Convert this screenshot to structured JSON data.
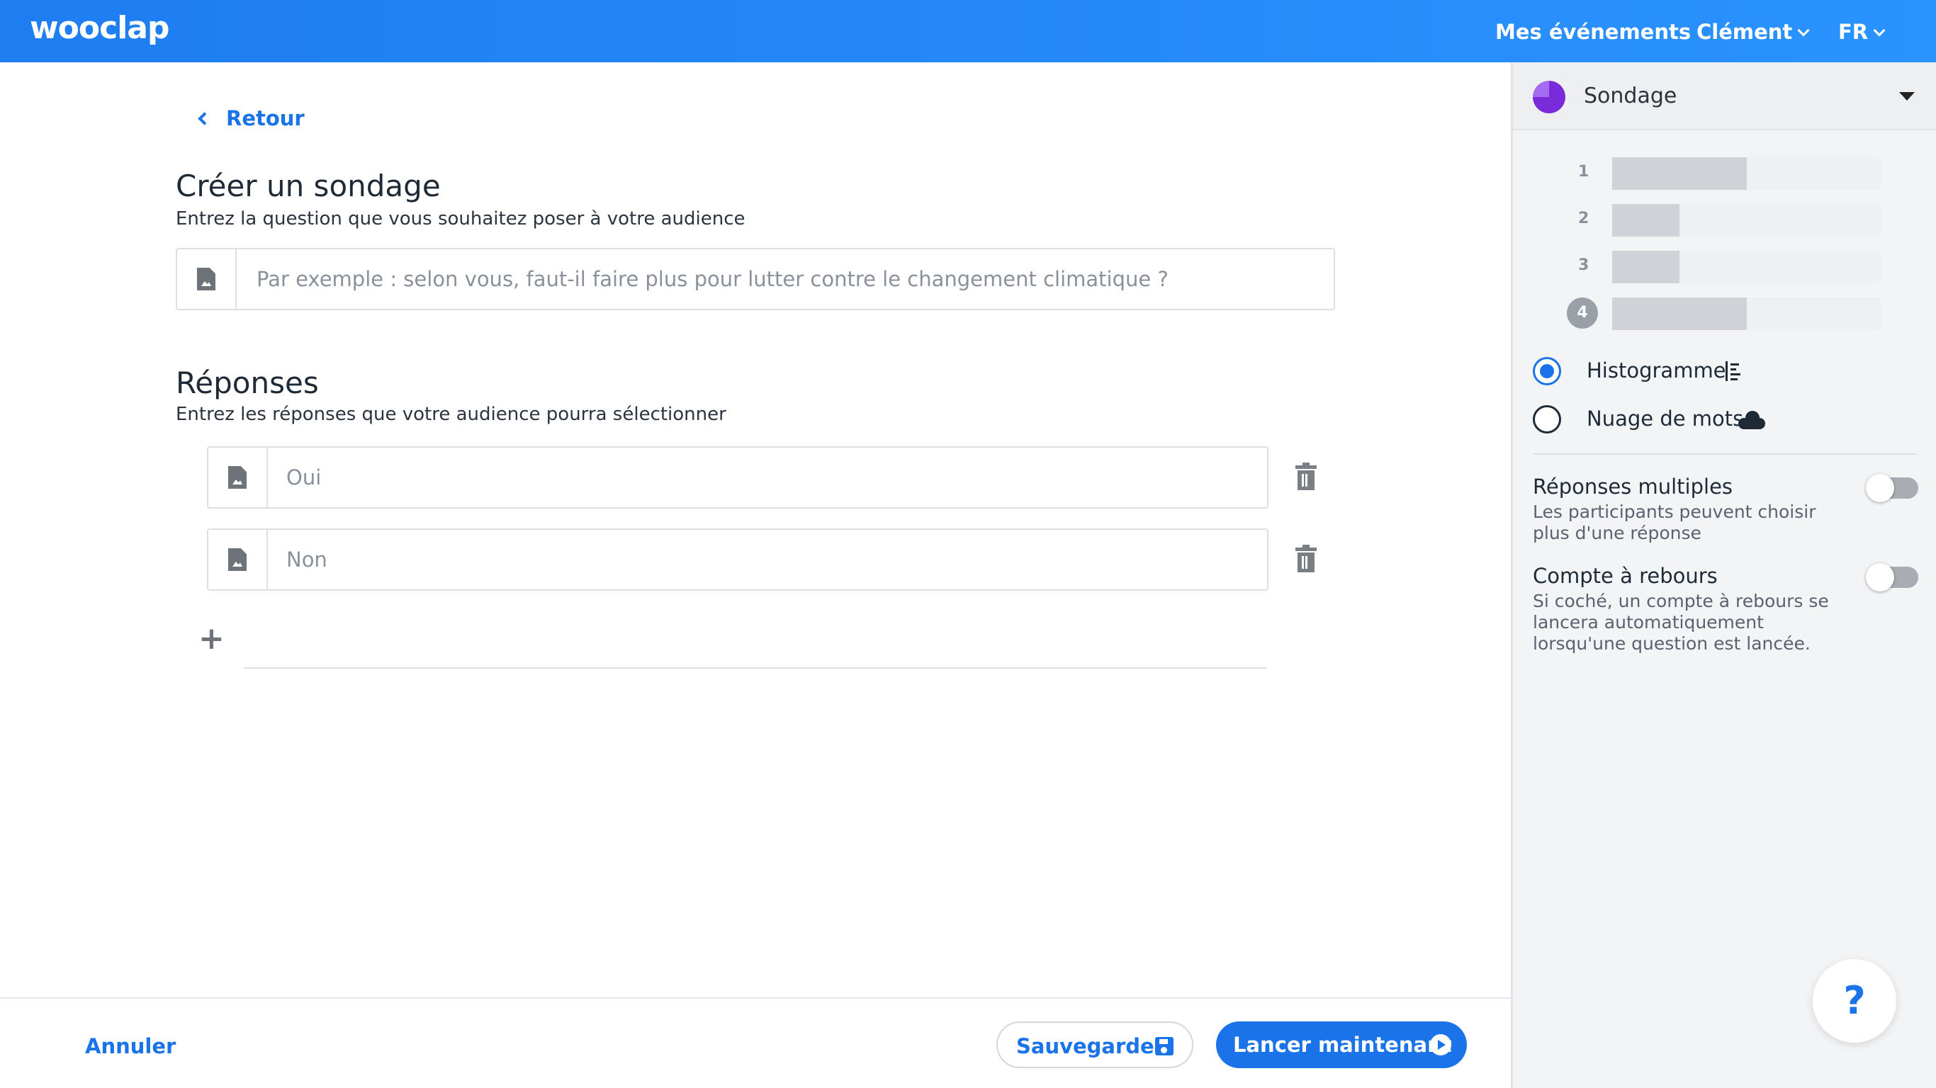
{
  "header": {
    "logo": "wooclap",
    "events_label": "Mes événements",
    "user_label": "Clément",
    "lang_label": "FR"
  },
  "main": {
    "back_label": "Retour",
    "title": "Créer un sondage",
    "subtitle": "Entrez la question que vous souhaitez poser à votre audience",
    "question_placeholder": "Par exemple : selon vous, faut-il faire plus pour lutter contre le changement climatique ?",
    "answers_title": "Réponses",
    "answers_subtitle": "Entrez les réponses que votre audience pourra sélectionner",
    "answers": [
      {
        "placeholder": "Oui"
      },
      {
        "placeholder": "Non"
      }
    ],
    "add_label": "+"
  },
  "footer": {
    "cancel_label": "Annuler",
    "save_label": "Sauvegarder",
    "launch_label": "Lancer maintenant"
  },
  "panel": {
    "type_label": "Sondage",
    "preview": {
      "ranks": [
        "1",
        "2",
        "3",
        "4"
      ],
      "values": [
        0.2,
        0.1,
        0.1,
        0.2
      ]
    },
    "display_options": [
      {
        "label": "Histogramme",
        "selected": true,
        "icon": "histogram-icon"
      },
      {
        "label": "Nuage de mots",
        "selected": false,
        "icon": "cloud-icon"
      }
    ],
    "settings": [
      {
        "title": "Réponses multiples",
        "description": "Les participants peuvent choisir plus d'une réponse",
        "enabled": false
      },
      {
        "title": "Compte à rebours",
        "description": "Si coché, un compte à rebours se lancera automatiquement lorsqu'une question est lancée.",
        "enabled": false
      }
    ]
  },
  "help": {
    "label": "?"
  },
  "colors": {
    "primary": "#1a73e8",
    "header_gradient_start": "#1e7df1",
    "poll_icon": "#7a2bd9"
  }
}
